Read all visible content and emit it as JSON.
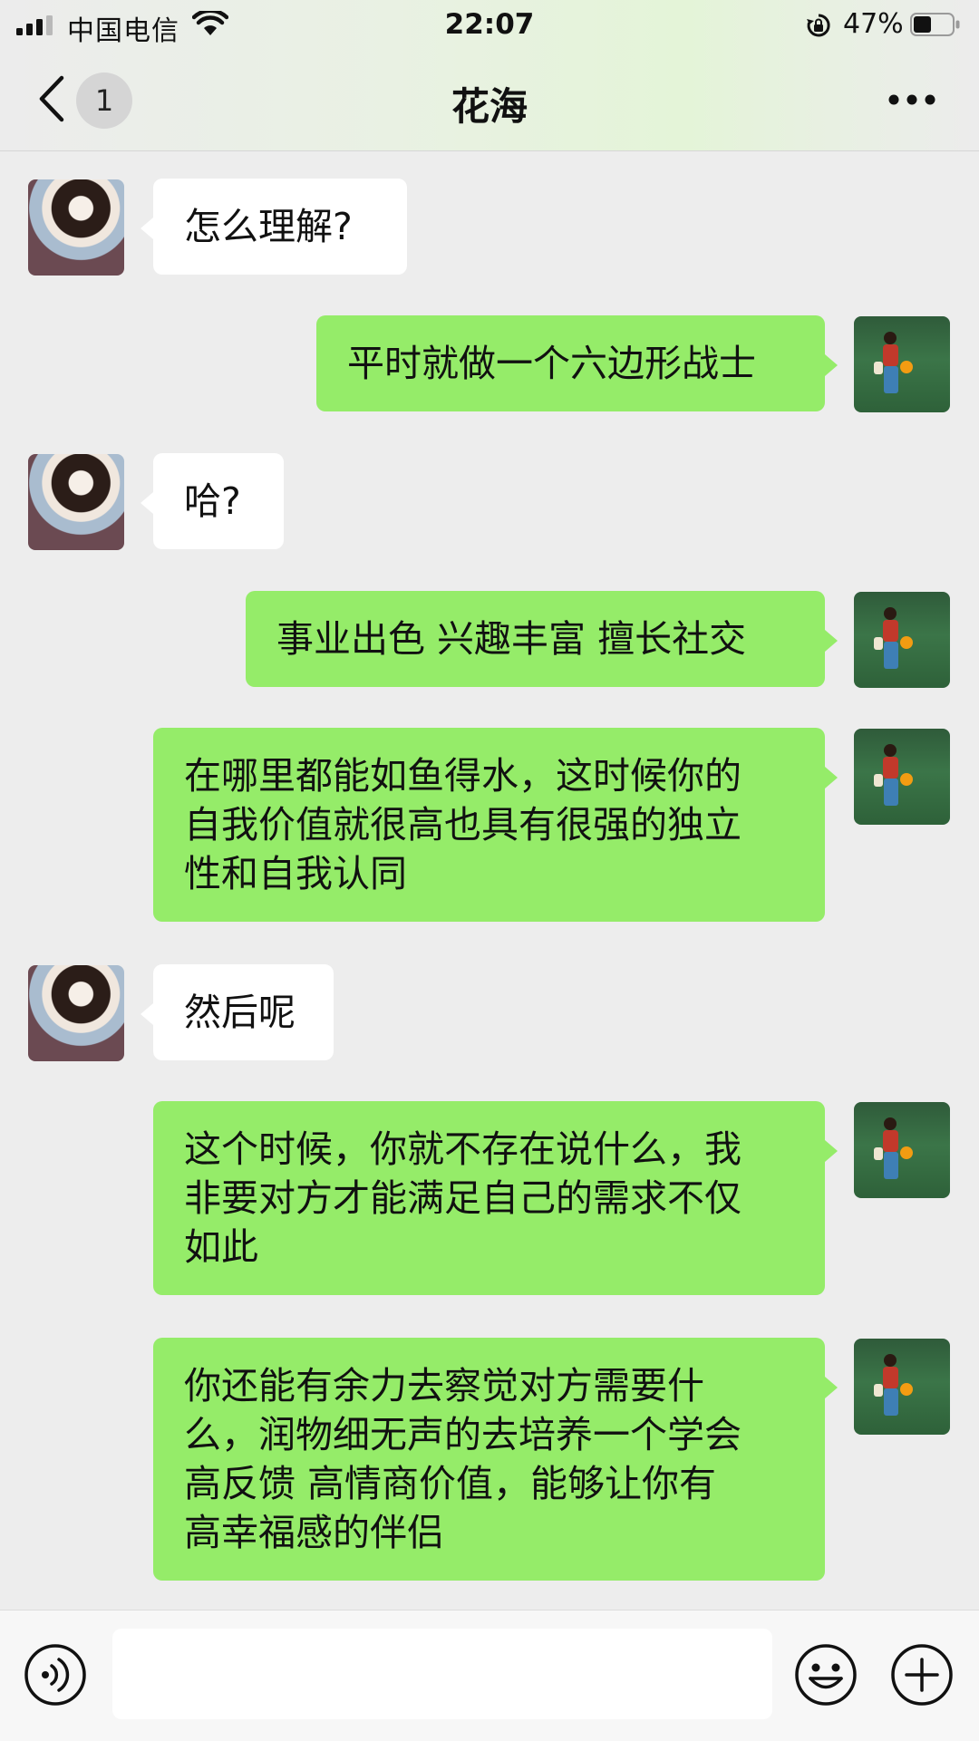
{
  "status_bar": {
    "carrier": "中国电信",
    "time": "22:07",
    "battery_percent": "47%",
    "battery_level": 0.47
  },
  "header": {
    "unread_count": "1",
    "title": "花海"
  },
  "messages": [
    {
      "side": "in",
      "lines": [
        "怎么理解?"
      ]
    },
    {
      "side": "out",
      "lines": [
        "平时就做一个六边形战士"
      ]
    },
    {
      "side": "in",
      "lines": [
        "哈?"
      ]
    },
    {
      "side": "out",
      "lines": [
        "事业出色 兴趣丰富 擅长社交"
      ]
    },
    {
      "side": "out",
      "lines": [
        "在哪里都能如鱼得水，这时候你的",
        "自我价值就很高也具有很强的独立",
        "性和自我认同"
      ]
    },
    {
      "side": "in",
      "lines": [
        "然后呢"
      ]
    },
    {
      "side": "out",
      "lines": [
        "这个时候，你就不存在说什么，我",
        "非要对方才能满足自己的需求不仅",
        "如此"
      ]
    },
    {
      "side": "out",
      "lines": [
        "你还能有余力去察觉对方需要什",
        "么，润物细无声的去培养一个学会",
        "高反馈 高情商价值，能够让你有",
        "高幸福感的伴侣"
      ]
    }
  ],
  "input": {
    "value": "",
    "placeholder": ""
  },
  "colors": {
    "outgoing_bubble": "#95ec69",
    "incoming_bubble": "#ffffff",
    "background": "#ededed"
  },
  "icons": [
    "signal-icon",
    "wifi-icon",
    "rotation-lock-icon",
    "battery-icon",
    "back-chevron-icon",
    "more-icon",
    "voice-icon",
    "emoji-icon",
    "plus-icon"
  ]
}
